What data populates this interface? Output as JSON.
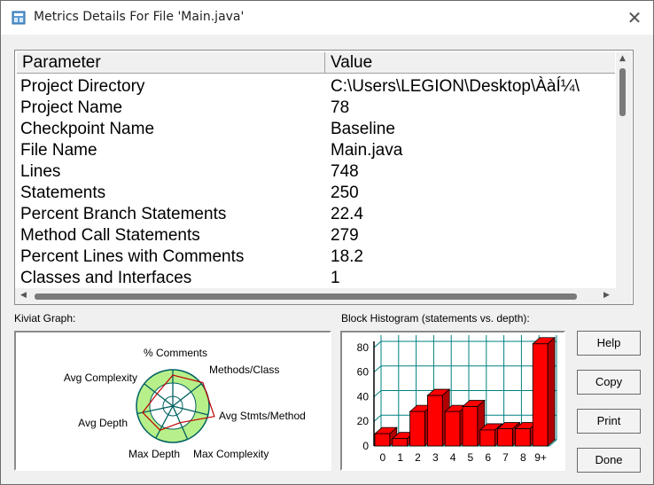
{
  "window": {
    "title": "Metrics Details For File 'Main.java'"
  },
  "table": {
    "headers": [
      "Parameter",
      "Value"
    ],
    "rows": [
      {
        "p": "Project Directory",
        "v": "C:\\Users\\LEGION\\Desktop\\ÀàÍ¼\\"
      },
      {
        "p": "Project Name",
        "v": "78"
      },
      {
        "p": "Checkpoint Name",
        "v": "Baseline"
      },
      {
        "p": "File Name",
        "v": "Main.java"
      },
      {
        "p": "Lines",
        "v": "748"
      },
      {
        "p": "Statements",
        "v": "250"
      },
      {
        "p": "Percent Branch Statements",
        "v": "22.4"
      },
      {
        "p": "Method Call Statements",
        "v": "279"
      },
      {
        "p": "Percent Lines with Comments",
        "v": "18.2"
      },
      {
        "p": "Classes and Interfaces",
        "v": "1"
      }
    ]
  },
  "kiviat": {
    "label": "Kiviat Graph:",
    "axes": [
      "% Comments",
      "Methods/Class",
      "Avg Stmts/Method",
      "Max Complexity",
      "Max Depth",
      "Avg Depth",
      "Avg Complexity"
    ]
  },
  "histogram": {
    "label": "Block Histogram (statements vs. depth):"
  },
  "chart_data": {
    "type": "bar",
    "categories": [
      "0",
      "1",
      "2",
      "3",
      "4",
      "5",
      "6",
      "7",
      "8",
      "9+"
    ],
    "values": [
      10,
      6,
      28,
      41,
      28,
      32,
      13,
      14,
      14,
      83
    ],
    "ylim": [
      0,
      85
    ],
    "yticks": [
      0,
      20,
      40,
      60,
      80
    ],
    "grid": true,
    "colors": {
      "bar": "#ff0000",
      "grid": "#008080"
    }
  },
  "buttons": {
    "help": "Help",
    "copy": "Copy",
    "print": "Print",
    "done": "Done"
  }
}
